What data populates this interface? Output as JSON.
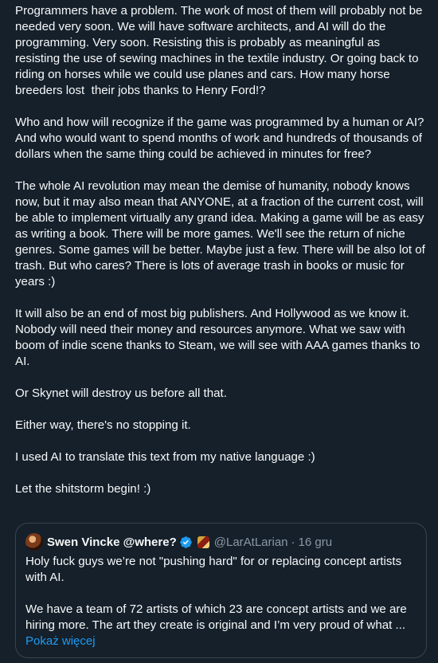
{
  "post": {
    "paragraphs": [
      "Programmers have a problem. The work of most of them will probably not be needed very soon. We will have software architects, and AI will do the programming. Very soon. Resisting this is probably as meaningful as resisting the use of sewing machines in the textile industry. Or going back to riding on horses while we could use planes and cars. How many horse breeders lost  their jobs thanks to Henry Ford!?",
      "Who and how will recognize if the game was programmed by a human or AI? And who would want to spend months of work and hundreds of thousands of dollars when the same thing could be achieved in minutes for free?",
      "The whole AI revolution may mean the demise of humanity, nobody knows now, but it may also mean that ANYONE, at a fraction of the current cost, will be able to implement virtually any grand idea. Making a game will be as easy as writing a book. There will be more games. We'll see the return of niche genres. Some games will be better. Maybe just a few. There will be also lot of trash. But who cares? There is lots of average trash in books or music for years :)",
      "It will also be an end of most big publishers. And Hollywood as we know it. Nobody will need their money and resources anymore. What we saw with boom of indie scene thanks to Steam, we will see with AAA games thanks to AI.",
      "Or Skynet will destroy us before all that.",
      "Either way, there's no stopping it.",
      "I used AI to translate this text from my native language :)",
      "Let the shitstorm begin! :)"
    ]
  },
  "quoted": {
    "display_name": "Swen Vincke @where?",
    "handle": "@LarAtLarian",
    "separator": "·",
    "date": "16 gru",
    "paragraphs": [
      "Holy fuck guys we’re not \"pushing hard\" for or replacing concept artists with AI.",
      "We have a team of 72 artists of which 23 are concept artists and we are hiring more. The art they create is original and I’m very proud of what ..."
    ],
    "show_more_label": "Pokaż więcej"
  },
  "icons": {
    "verified": "verified-badge-icon",
    "affiliate": "affiliate-badge-icon"
  },
  "colors": {
    "background": "#15202b",
    "text": "#f7f9f9",
    "muted": "#8b98a5",
    "link": "#1d9bf0",
    "border": "#38444d",
    "verified": "#1d9bf0"
  }
}
